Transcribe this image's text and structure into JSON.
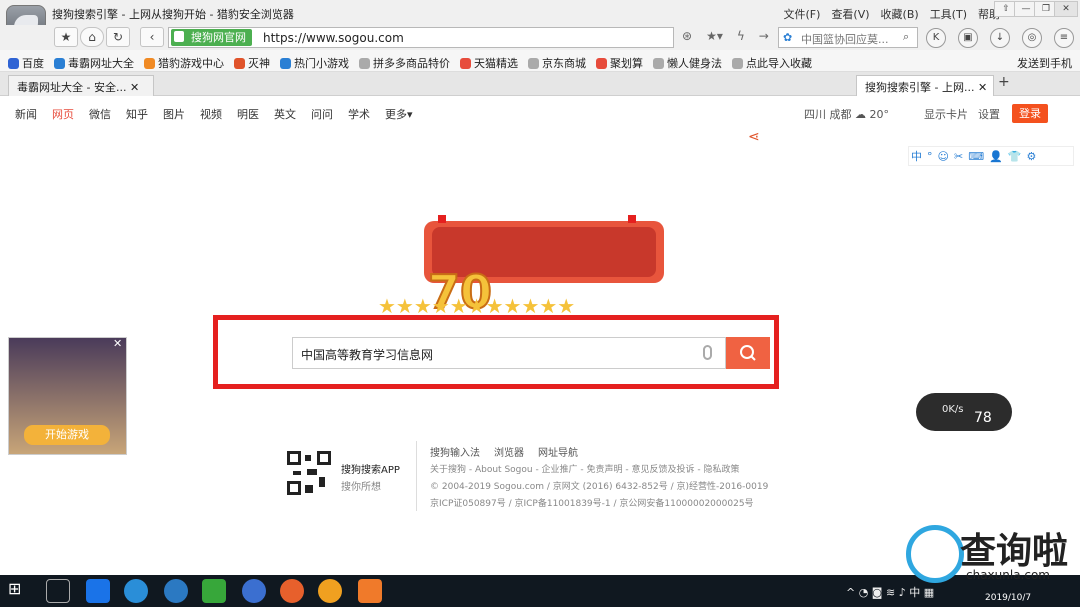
{
  "window": {
    "title": "搜狗搜索引擎 - 上网从搜狗开始 - 猎豹安全浏览器",
    "menus": [
      "文件(F)",
      "查看(V)",
      "收藏(B)",
      "工具(T)",
      "帮助"
    ],
    "controls": [
      "⇧",
      "—",
      "❐",
      "✕"
    ]
  },
  "addressbar": {
    "secure_label": "搜狗网官网",
    "url": "https://www.sogou.com",
    "search_placeholder": "中国篮协回应莫..."
  },
  "bookmarks": {
    "items": [
      {
        "label": "百度",
        "color": "#3064d4"
      },
      {
        "label": "毒霸网址大全",
        "color": "#2a7fd4"
      },
      {
        "label": "猎豹游戏中心",
        "color": "#f08a24"
      },
      {
        "label": "灭神",
        "color": "#e0532a"
      },
      {
        "label": "热门小游戏",
        "color": "#2a7fd4"
      },
      {
        "label": "拼多多商品特价",
        "color": "#aaa"
      },
      {
        "label": "天猫精选",
        "color": "#e74c3c"
      },
      {
        "label": "京东商城",
        "color": "#aaa"
      },
      {
        "label": "聚划算",
        "color": "#e74c3c"
      },
      {
        "label": "懒人健身法",
        "color": "#aaa"
      },
      {
        "label": "点此导入收藏",
        "color": "#aaa"
      }
    ],
    "right": "发送到手机"
  },
  "tabs": [
    {
      "label": "毒霸网址大全 - 安全...",
      "close": "✕"
    },
    {
      "label": "搜狗搜索引擎 - 上网...",
      "close": "✕"
    }
  ],
  "newtab": "+",
  "nav": {
    "items": [
      "新闻",
      "网页",
      "微信",
      "知乎",
      "图片",
      "视频",
      "明医",
      "英文",
      "问问",
      "学术",
      "更多▾"
    ],
    "current": 1
  },
  "weather": "四川 成都  ☁  20°",
  "showcard": "显示卡片",
  "settings": "设置",
  "login": "登录",
  "share_icon": "share-icon",
  "ime": [
    "中",
    "°",
    "☺",
    "✂",
    "⌨",
    "👤",
    "👕",
    "⚙"
  ],
  "doodle": {
    "number": "70",
    "stars": "★★★★★★★★★★★"
  },
  "search": {
    "query": "中国高等教育学习信息网"
  },
  "footer": {
    "app_title": "搜狗搜索APP",
    "app_sub": "搜你所想",
    "links": [
      "搜狗输入法",
      "浏览器",
      "网址导航"
    ],
    "line1": "关于搜狗 - About Sogou - 企业推广 - 免责声明 - 意见反馈及投诉 - 隐私政策",
    "line2": "© 2004-2019 Sogou.com / 京网文 (2016) 6432-852号 / 京)经营性-2016-0019",
    "line3": "京ICP证050897号 / 京ICP备11001839号-1 / 京公网安备11000002000025号"
  },
  "ad": {
    "button": "开始游戏",
    "close": "✕"
  },
  "speed": {
    "value": "0K/s",
    "percent": "78"
  },
  "watermark": {
    "title": "查询啦",
    "sub": "chaxunla.com"
  },
  "taskbar": {
    "tray": "^ ◔ ◙ ≋ ♪ 中 ▦",
    "date": "2019/10/7"
  },
  "chart_data": {
    "type": "table",
    "title": "",
    "categories": [],
    "values": []
  }
}
